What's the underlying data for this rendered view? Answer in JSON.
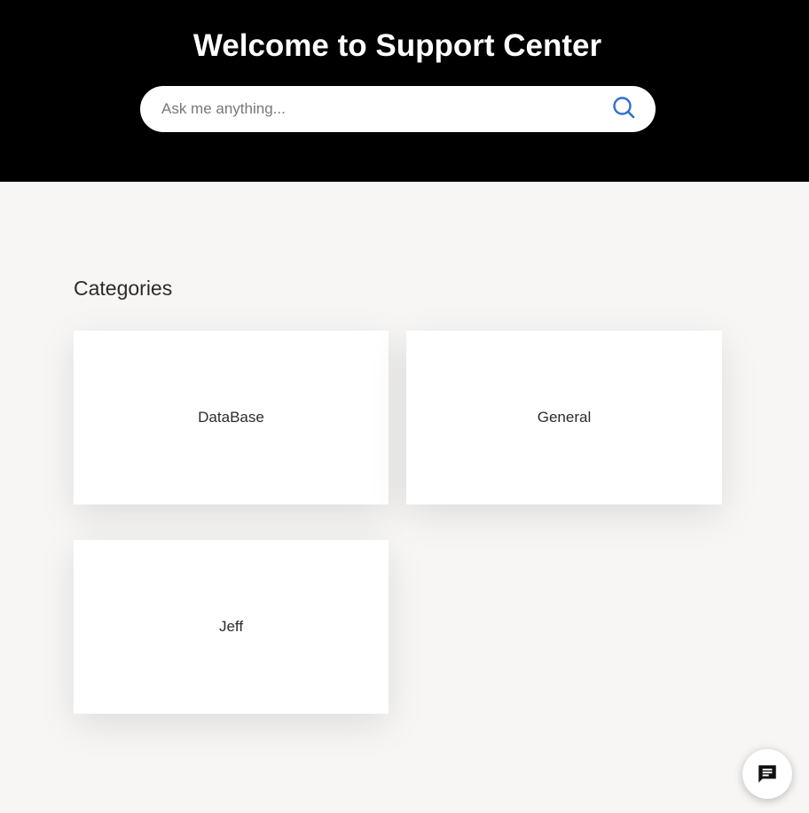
{
  "hero": {
    "title": "Welcome to Support Center",
    "background_color": "#000000"
  },
  "search": {
    "placeholder": "Ask me anything...",
    "value": "",
    "icon": "search-icon",
    "icon_color": "#2f6fcf"
  },
  "categories": {
    "heading": "Categories",
    "items": [
      {
        "label": "DataBase"
      },
      {
        "label": "General"
      },
      {
        "label": "Jeff"
      }
    ]
  },
  "chat_launcher": {
    "icon": "chat-bubble-icon"
  }
}
